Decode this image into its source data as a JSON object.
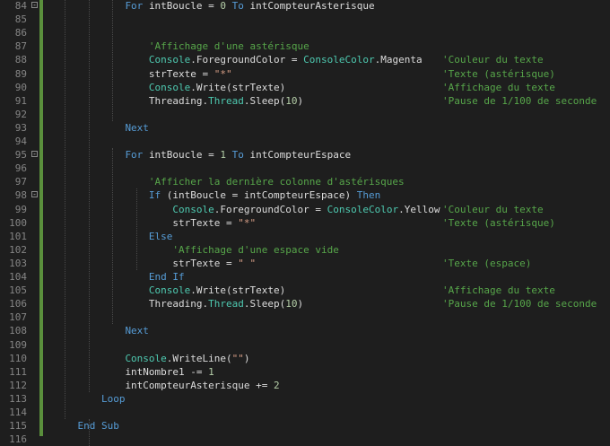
{
  "editor": {
    "lines": [
      {
        "n": "84",
        "fold": "-",
        "code": [
          [
            "kw",
            "For "
          ],
          [
            "pl",
            "intBoucle = "
          ],
          [
            "num",
            "0"
          ],
          [
            "kw",
            " To "
          ],
          [
            "pl",
            "intCompteurAsterisque"
          ]
        ],
        "indent": 6,
        "comment": ""
      },
      {
        "n": "85",
        "fold": "",
        "code": [],
        "indent": 0,
        "comment": ""
      },
      {
        "n": "86",
        "fold": "",
        "code": [],
        "indent": 0,
        "comment": ""
      },
      {
        "n": "87",
        "fold": "",
        "code": [
          [
            "cm",
            "'Affichage d'une astérisque"
          ]
        ],
        "indent": 8,
        "comment": ""
      },
      {
        "n": "88",
        "fold": "",
        "code": [
          [
            "ty",
            "Console"
          ],
          [
            "pl",
            "."
          ],
          [
            "pl",
            "ForegroundColor = "
          ],
          [
            "ty",
            "ConsoleColor"
          ],
          [
            "pl",
            "."
          ],
          [
            "pl",
            "Magenta"
          ]
        ],
        "indent": 8,
        "comment": "'Couleur du texte"
      },
      {
        "n": "89",
        "fold": "",
        "code": [
          [
            "pl",
            "strTexte = "
          ],
          [
            "str",
            "\"*\""
          ]
        ],
        "indent": 8,
        "comment": "'Texte (astérisque)"
      },
      {
        "n": "90",
        "fold": "",
        "code": [
          [
            "ty",
            "Console"
          ],
          [
            "pl",
            ".Write(strTexte)"
          ]
        ],
        "indent": 8,
        "comment": "'Affichage du texte"
      },
      {
        "n": "91",
        "fold": "",
        "code": [
          [
            "pl",
            "Threading."
          ],
          [
            "ty",
            "Thread"
          ],
          [
            "pl",
            ".Sleep("
          ],
          [
            "num",
            "10"
          ],
          [
            "pl",
            ")"
          ]
        ],
        "indent": 8,
        "comment": "'Pause de 1/100 de seconde"
      },
      {
        "n": "92",
        "fold": "",
        "code": [],
        "indent": 0,
        "comment": ""
      },
      {
        "n": "93",
        "fold": "",
        "code": [
          [
            "kw",
            "Next"
          ]
        ],
        "indent": 6,
        "comment": ""
      },
      {
        "n": "94",
        "fold": "",
        "code": [],
        "indent": 0,
        "comment": ""
      },
      {
        "n": "95",
        "fold": "-",
        "code": [
          [
            "kw",
            "For "
          ],
          [
            "pl",
            "intBoucle = "
          ],
          [
            "num",
            "1"
          ],
          [
            "kw",
            " To "
          ],
          [
            "pl",
            "intCompteurEspace"
          ]
        ],
        "indent": 6,
        "comment": ""
      },
      {
        "n": "96",
        "fold": "",
        "code": [],
        "indent": 0,
        "comment": ""
      },
      {
        "n": "97",
        "fold": "",
        "code": [
          [
            "cm",
            "'Afficher la dernière colonne d'astérisques"
          ]
        ],
        "indent": 8,
        "comment": ""
      },
      {
        "n": "98",
        "fold": "-",
        "code": [
          [
            "kw",
            "If "
          ],
          [
            "pl",
            "(intBoucle = intCompteurEspace) "
          ],
          [
            "kw",
            "Then"
          ]
        ],
        "indent": 8,
        "comment": ""
      },
      {
        "n": "99",
        "fold": "",
        "code": [
          [
            "ty",
            "Console"
          ],
          [
            "pl",
            "."
          ],
          [
            "pl",
            "ForegroundColor = "
          ],
          [
            "ty",
            "ConsoleColor"
          ],
          [
            "pl",
            "."
          ],
          [
            "pl",
            "Yellow"
          ]
        ],
        "indent": 10,
        "comment": "'Couleur du texte"
      },
      {
        "n": "100",
        "fold": "",
        "code": [
          [
            "pl",
            "strTexte = "
          ],
          [
            "str",
            "\"*\""
          ]
        ],
        "indent": 10,
        "comment": "'Texte (astérisque)"
      },
      {
        "n": "101",
        "fold": "",
        "code": [
          [
            "kw",
            "Else"
          ]
        ],
        "indent": 8,
        "comment": ""
      },
      {
        "n": "102",
        "fold": "",
        "code": [
          [
            "cm",
            "'Affichage d'une espace vide"
          ]
        ],
        "indent": 10,
        "comment": ""
      },
      {
        "n": "103",
        "fold": "",
        "code": [
          [
            "pl",
            "strTexte = "
          ],
          [
            "str",
            "\" \""
          ]
        ],
        "indent": 10,
        "comment": "'Texte (espace)"
      },
      {
        "n": "104",
        "fold": "",
        "code": [
          [
            "kw",
            "End If"
          ]
        ],
        "indent": 8,
        "comment": ""
      },
      {
        "n": "105",
        "fold": "",
        "code": [
          [
            "ty",
            "Console"
          ],
          [
            "pl",
            ".Write(strTexte)"
          ]
        ],
        "indent": 8,
        "comment": "'Affichage du texte"
      },
      {
        "n": "106",
        "fold": "",
        "code": [
          [
            "pl",
            "Threading."
          ],
          [
            "ty",
            "Thread"
          ],
          [
            "pl",
            ".Sleep("
          ],
          [
            "num",
            "10"
          ],
          [
            "pl",
            ")"
          ]
        ],
        "indent": 8,
        "comment": "'Pause de 1/100 de seconde"
      },
      {
        "n": "107",
        "fold": "",
        "code": [],
        "indent": 0,
        "comment": ""
      },
      {
        "n": "108",
        "fold": "",
        "code": [
          [
            "kw",
            "Next"
          ]
        ],
        "indent": 6,
        "comment": ""
      },
      {
        "n": "109",
        "fold": "",
        "code": [],
        "indent": 0,
        "comment": ""
      },
      {
        "n": "110",
        "fold": "",
        "code": [
          [
            "ty",
            "Console"
          ],
          [
            "pl",
            ".WriteLine("
          ],
          [
            "str",
            "\"\""
          ],
          [
            "pl",
            ")"
          ]
        ],
        "indent": 6,
        "comment": ""
      },
      {
        "n": "111",
        "fold": "",
        "code": [
          [
            "pl",
            "intNombre1 -= "
          ],
          [
            "num",
            "1"
          ]
        ],
        "indent": 6,
        "comment": ""
      },
      {
        "n": "112",
        "fold": "",
        "code": [
          [
            "pl",
            "intCompteurAsterisque += "
          ],
          [
            "num",
            "2"
          ]
        ],
        "indent": 6,
        "comment": ""
      },
      {
        "n": "113",
        "fold": "",
        "code": [
          [
            "kw",
            "Loop"
          ]
        ],
        "indent": 4,
        "comment": ""
      },
      {
        "n": "114",
        "fold": "",
        "code": [],
        "indent": 0,
        "comment": ""
      },
      {
        "n": "115",
        "fold": "",
        "code": [
          [
            "kw",
            "End Sub"
          ]
        ],
        "indent": 2,
        "comment": ""
      },
      {
        "n": "116",
        "fold": "",
        "code": [],
        "indent": 0,
        "comment": ""
      }
    ],
    "colors": {
      "background": "#1e1e1e",
      "keyword": "#569cd6",
      "type": "#4ec9b0",
      "string": "#d69d85",
      "number": "#b5cea8",
      "comment": "#57a64a",
      "plain": "#dcdcdc",
      "line_number": "#858585",
      "change_bar": "#5a8f3c"
    }
  }
}
